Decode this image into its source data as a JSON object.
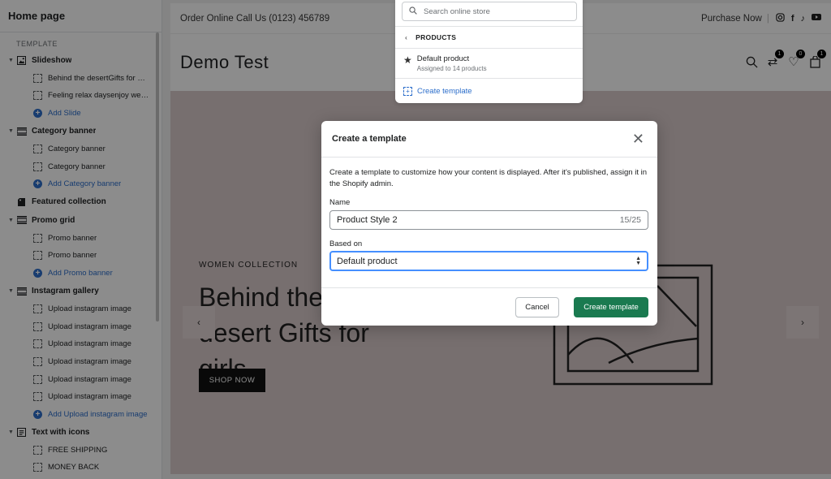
{
  "sidebar": {
    "title": "Home page",
    "section_title": "TEMPLATE",
    "items": [
      {
        "type": "section",
        "label": "Slideshow",
        "icon": "image-icon",
        "caret": true
      },
      {
        "type": "block",
        "label": "Behind the desertGifts for girls"
      },
      {
        "type": "block",
        "label": "Feeling relax daysenjoy weekend"
      },
      {
        "type": "add",
        "label": "Add Slide"
      },
      {
        "type": "section",
        "label": "Category banner",
        "icon": "banner-icon",
        "caret": true
      },
      {
        "type": "block",
        "label": "Category banner"
      },
      {
        "type": "block",
        "label": "Category banner"
      },
      {
        "type": "add",
        "label": "Add Category banner"
      },
      {
        "type": "section",
        "label": "Featured collection",
        "icon": "collection-icon",
        "caret": false
      },
      {
        "type": "section",
        "label": "Promo grid",
        "icon": "banner-icon",
        "caret": true
      },
      {
        "type": "block",
        "label": "Promo banner"
      },
      {
        "type": "block",
        "label": "Promo banner"
      },
      {
        "type": "add",
        "label": "Add Promo banner"
      },
      {
        "type": "section",
        "label": "Instagram gallery",
        "icon": "banner-icon",
        "caret": true
      },
      {
        "type": "block",
        "label": "Upload instagram image"
      },
      {
        "type": "block",
        "label": "Upload instagram image"
      },
      {
        "type": "block",
        "label": "Upload instagram image"
      },
      {
        "type": "block",
        "label": "Upload instagram image"
      },
      {
        "type": "block",
        "label": "Upload instagram image"
      },
      {
        "type": "block",
        "label": "Upload instagram image"
      },
      {
        "type": "add",
        "label": "Add Upload instagram image"
      },
      {
        "type": "section",
        "label": "Text with icons",
        "icon": "text-icon",
        "caret": true
      },
      {
        "type": "block",
        "label": "FREE SHIPPING"
      },
      {
        "type": "block",
        "label": "MONEY BACK"
      }
    ]
  },
  "preview": {
    "topbar_left": "Order Online Call Us (0123) 456789",
    "topbar_right": "Purchase Now",
    "socials": [
      "instagram-icon",
      "facebook-icon",
      "tiktok-icon",
      "youtube-icon"
    ],
    "site_title": "Demo Test",
    "badges": {
      "compare": "1",
      "wishlist": "0",
      "cart": "1"
    },
    "hero_subtitle": "WOMEN COLLECTION",
    "hero_title": "Behind the desert Gifts for girls",
    "hero_button": "SHOP NOW"
  },
  "search_dropdown": {
    "placeholder": "Search online store",
    "category": "PRODUCTS",
    "item_title": "Default product",
    "item_subtitle": "Assigned to 14 products",
    "create_label": "Create template"
  },
  "modal": {
    "title": "Create a template",
    "description": "Create a template to customize how your content is displayed. After it's published, assign it in the Shopify admin.",
    "name_label": "Name",
    "name_value": "Product Style 2",
    "name_count": "15/25",
    "based_on_label": "Based on",
    "based_on_value": "Default product",
    "cancel_label": "Cancel",
    "create_label": "Create template"
  },
  "colors": {
    "accent": "#2c6ecb",
    "primary_button": "#1a7a50",
    "hero_bg": "#d9caca"
  }
}
